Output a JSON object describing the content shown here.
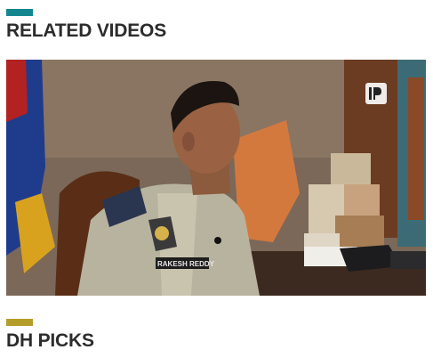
{
  "sections": {
    "related_videos": {
      "title": "RELATED VIDEOS",
      "accent_color": "#14868f"
    },
    "dh_picks": {
      "title": "DH PICKS",
      "accent_color": "#b59d2a"
    }
  },
  "video": {
    "thumbnail_subject": "police-officer-interview",
    "name_tag": "RAKESH REDDY",
    "watermark_icon": "ani-logo-icon"
  }
}
